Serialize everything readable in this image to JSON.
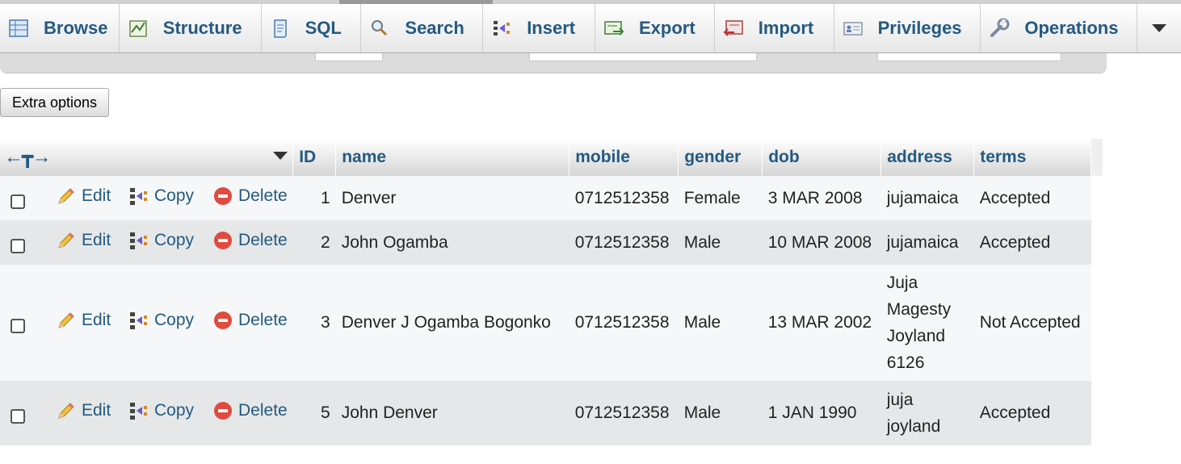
{
  "tabs": [
    {
      "label": "Browse",
      "icon": "browse-icon"
    },
    {
      "label": "Structure",
      "icon": "structure-icon"
    },
    {
      "label": "SQL",
      "icon": "sql-icon"
    },
    {
      "label": "Search",
      "icon": "search-icon"
    },
    {
      "label": "Insert",
      "icon": "insert-icon"
    },
    {
      "label": "Export",
      "icon": "export-icon"
    },
    {
      "label": "Import",
      "icon": "import-icon"
    },
    {
      "label": "Privileges",
      "icon": "privileges-icon"
    },
    {
      "label": "Operations",
      "icon": "operations-icon"
    }
  ],
  "extra_options_label": "Extra options",
  "table": {
    "columns": [
      "ID",
      "name",
      "mobile",
      "gender",
      "dob",
      "address",
      "terms"
    ],
    "action_labels": {
      "edit": "Edit",
      "copy": "Copy",
      "delete": "Delete"
    },
    "rows": [
      {
        "id": "1",
        "name": "Denver",
        "mobile": "0712512358",
        "gender": "Female",
        "dob": "3 MAR 2008",
        "address": [
          "jujamaica"
        ],
        "terms": "Accepted"
      },
      {
        "id": "2",
        "name": "John Ogamba",
        "mobile": "0712512358",
        "gender": "Male",
        "dob": "10 MAR 2008",
        "address": [
          "jujamaica"
        ],
        "terms": "Accepted"
      },
      {
        "id": "3",
        "name": "Denver J Ogamba Bogonko",
        "mobile": "0712512358",
        "gender": "Male",
        "dob": "13 MAR 2002",
        "address": [
          "Juja",
          "Magesty",
          "Joyland",
          "6126"
        ],
        "terms": "Not Accepted"
      },
      {
        "id": "5",
        "name": "John Denver",
        "mobile": "0712512358",
        "gender": "Male",
        "dob": "1 JAN 1990",
        "address": [
          "juja",
          "joyland"
        ],
        "terms": "Accepted"
      }
    ]
  },
  "colors": {
    "link": "#235a81",
    "row_odd": "#f6f7f8",
    "row_even": "#e6e7e8",
    "delete": "#e04a3f"
  }
}
